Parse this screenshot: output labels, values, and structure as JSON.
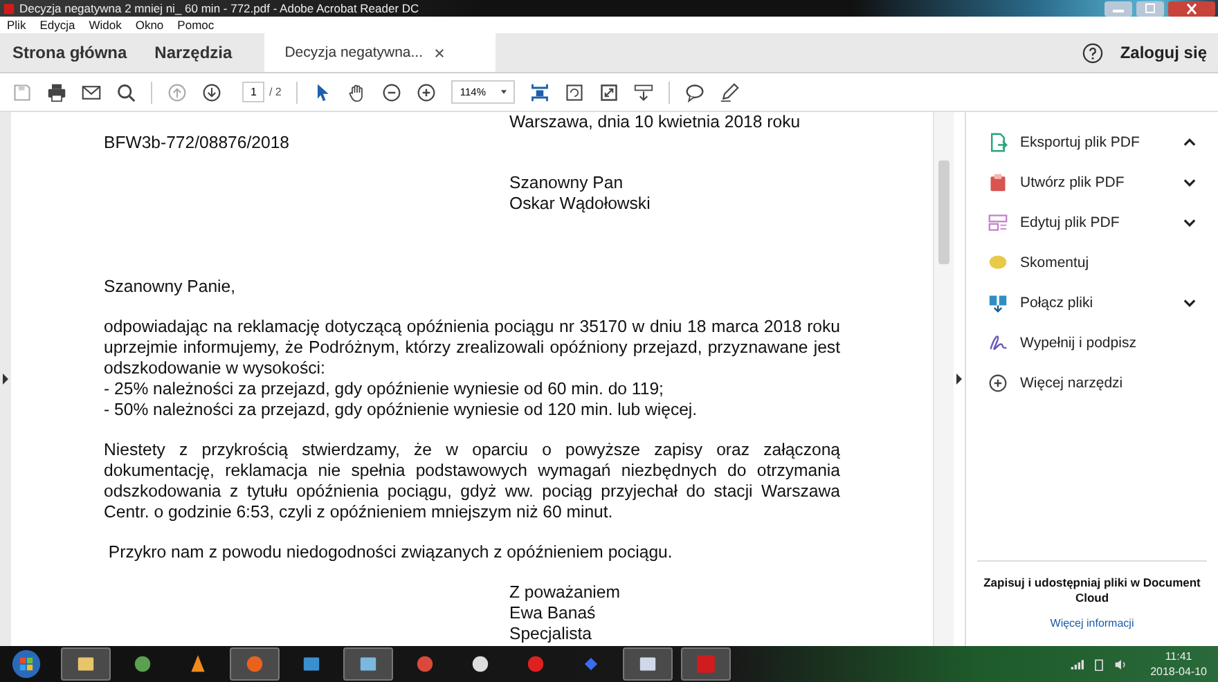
{
  "window": {
    "title": "Decyzja negatywna 2 mniej ni_ 60 min - 772.pdf - Adobe Acrobat Reader DC"
  },
  "menu": [
    "Plik",
    "Edycja",
    "Widok",
    "Okno",
    "Pomoc"
  ],
  "tabs": [
    {
      "label": "Strona główna",
      "selected": false,
      "closable": false
    },
    {
      "label": "Narzędzia",
      "selected": false,
      "closable": false
    },
    {
      "label": "Decyzja negatywna...",
      "selected": true,
      "closable": true
    }
  ],
  "account": {
    "label": "Zaloguj się"
  },
  "toolbar": {
    "page": "1",
    "page_total": "/ 2",
    "zoom": "114%"
  },
  "document": {
    "blocks": [
      {
        "kind": "address",
        "lines": [
          {
            "text": "Warszawa, dnia 10 kwietnia 2018 roku"
          }
        ]
      },
      {
        "kind": "reference",
        "lines": [
          {
            "text": "BFW3b-772/08876/2018"
          }
        ]
      },
      {
        "kind": "address",
        "lines": [
          {
            "text": "Szanowny Pan"
          },
          {
            "text": "Oskar Wądołowski"
          }
        ]
      },
      {
        "kind": "salutation",
        "lines": [
          {
            "text": "Szanowny Panie,"
          }
        ]
      },
      {
        "kind": "body",
        "lines": [
          {
            "text": "odpowiadając na reklamację dotyczącą opóźnienia pociągu nr 35170 w dniu 18 marca 2018 roku",
            "justify": true
          },
          {
            "text": "uprzejmie informujemy, że Podróżnym, którzy zrealizowali opóźniony przejazd, przyznawane jest",
            "justify": true
          },
          {
            "text": "odszkodowanie w wysokości:",
            "justify": false
          },
          {
            "text": "- 25% należności za przejazd, gdy opóźnienie wyniesie od 60 min. do 119;",
            "justify": false
          },
          {
            "text": "- 50% należności za przejazd, gdy opóźnienie wyniesie od 120 min. lub więcej.",
            "justify": false
          }
        ]
      },
      {
        "kind": "body",
        "lines": [
          {
            "text": "Niestety z przykrością stwierdzamy, że w oparciu o powyższe zapisy oraz załączoną",
            "justify": true
          },
          {
            "text": "dokumentację, reklamacja nie spełnia podstawowych wymagań niezbędnych do otrzymania",
            "justify": true
          },
          {
            "text": "odszkodowania z tytułu opóźnienia pociągu, gdyż ww. pociąg przyjechał do stacji Warszawa",
            "justify": true
          },
          {
            "text": "Centr. o godzinie 6:53, czyli z opóźnieniem mniejszym niż 60 minut.",
            "justify": false
          }
        ]
      },
      {
        "kind": "body",
        "lines": [
          {
            "text": " Przykro nam z powodu niedogodności związanych z opóźnieniem pociągu.",
            "justify": false
          }
        ]
      },
      {
        "kind": "address",
        "lines": [
          {
            "text": "Z poważaniem"
          },
          {
            "text": "Ewa Banaś"
          },
          {
            "text": "Specjalista"
          }
        ]
      }
    ]
  },
  "tools": [
    {
      "kind": "export",
      "label": "Eksportuj plik PDF",
      "expanded": true
    },
    {
      "kind": "create",
      "label": "Utwórz plik PDF",
      "expanded": false
    },
    {
      "kind": "edit",
      "label": "Edytuj plik PDF",
      "expanded": false
    },
    {
      "kind": "comment",
      "label": "Skomentuj"
    },
    {
      "kind": "combine",
      "label": "Połącz pliki",
      "expanded": false
    },
    {
      "kind": "sign",
      "label": "Wypełnij i podpisz"
    },
    {
      "kind": "more",
      "label": "Więcej narzędzi"
    }
  ],
  "cloud": {
    "text": "Zapisuj i udostępniaj pliki w Document Cloud",
    "link": "Więcej informacji"
  },
  "taskbar": {
    "apps": [
      {
        "kind": "folder",
        "open": true
      },
      {
        "kind": "globe",
        "open": false
      },
      {
        "kind": "cone",
        "open": false
      },
      {
        "kind": "fox",
        "open": true
      },
      {
        "kind": "pen",
        "open": false
      },
      {
        "kind": "tablet",
        "open": true
      },
      {
        "kind": "chrome",
        "open": false
      },
      {
        "kind": "gear",
        "open": false
      },
      {
        "kind": "bug",
        "open": false
      },
      {
        "kind": "dots",
        "open": false
      },
      {
        "kind": "monitor",
        "open": true
      },
      {
        "kind": "acrobat",
        "open": true
      }
    ],
    "time": "11:41",
    "date": "2018-04-10"
  }
}
